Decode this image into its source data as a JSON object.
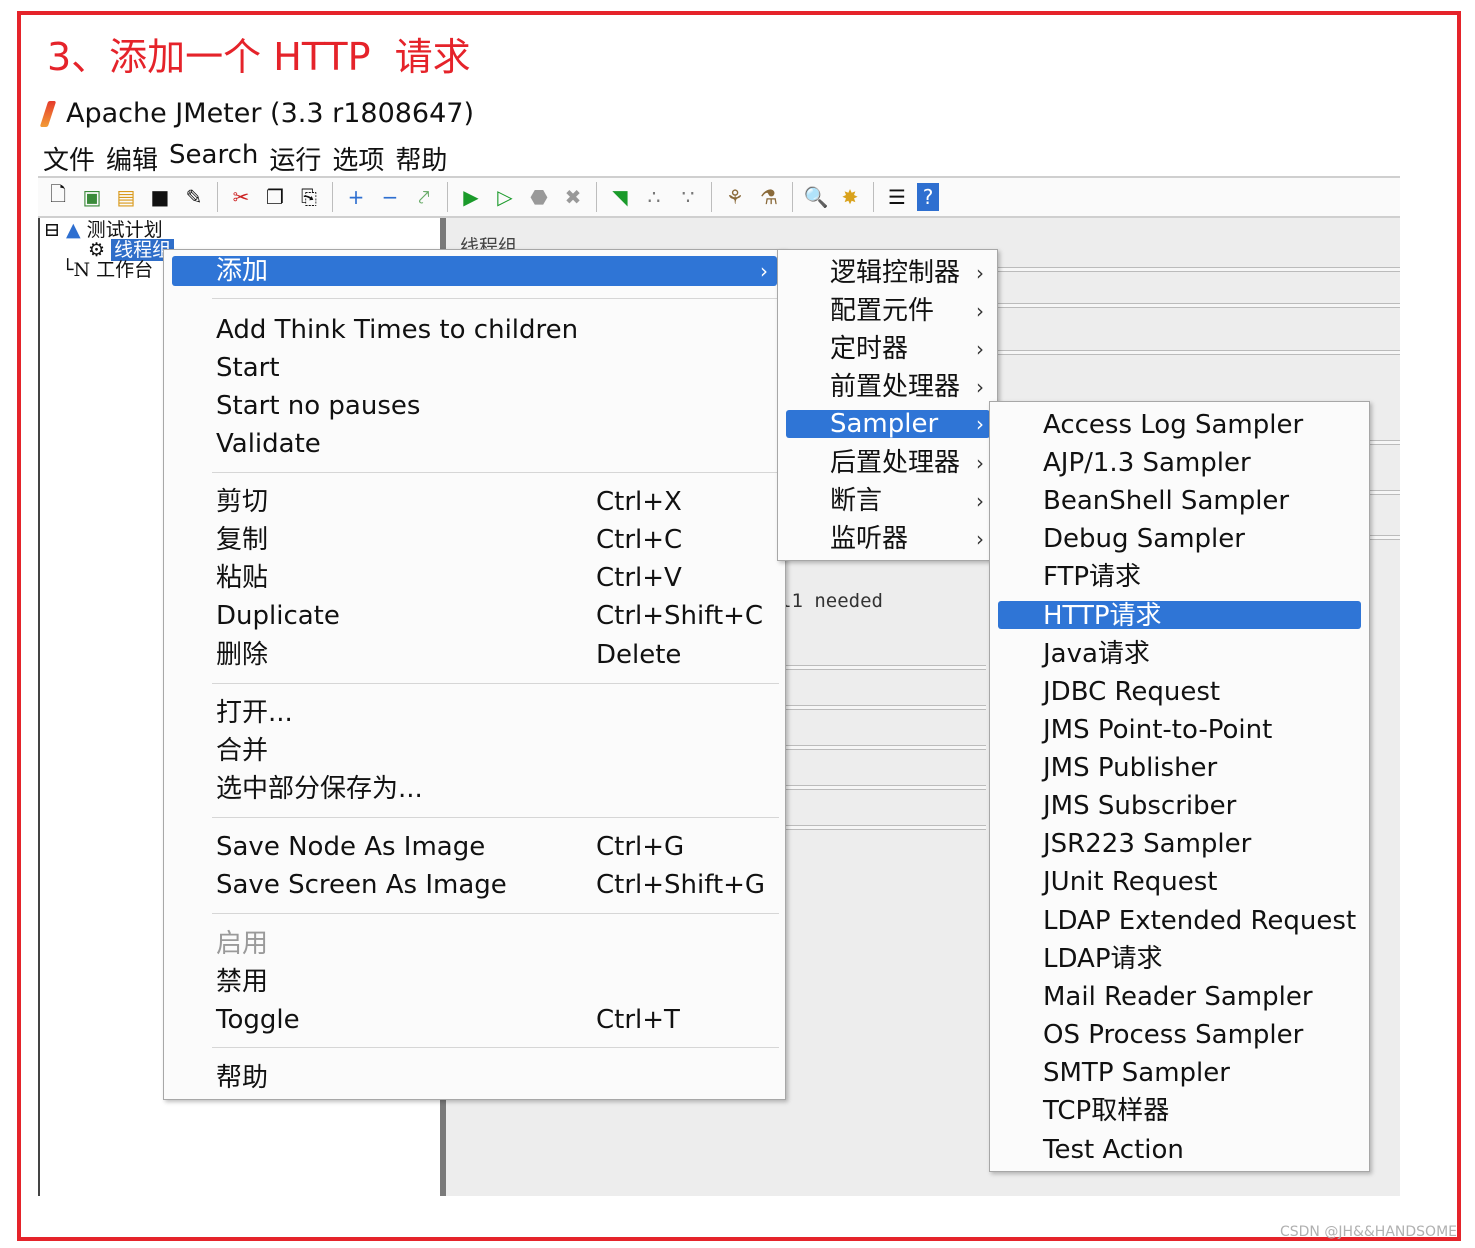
{
  "heading": "3、添加一个 HTTP  请求",
  "app": {
    "title": "Apache JMeter (3.3 r1808647)",
    "menubar": [
      "文件",
      "编辑",
      "Search",
      "运行",
      "选项",
      "帮助"
    ]
  },
  "toolbar_icons": [
    "new-icon",
    "templates-icon",
    "open-icon",
    "save-icon",
    "save-as-icon",
    "cut-icon",
    "copy-icon",
    "paste-icon",
    "expand-icon",
    "collapse-icon",
    "toggle-icon",
    "start-icon",
    "start-no-pause-icon",
    "stop-icon",
    "shutdown-icon",
    "remote-start-icon",
    "remote-stop-icon",
    "remote-shutdown-icon",
    "clear-icon",
    "clear-all-icon",
    "search-icon",
    "reset-search-icon",
    "function-helper-icon",
    "help-icon"
  ],
  "tree": {
    "test_plan": "测试计划",
    "thread_group": "线程组",
    "workbench": "工作台"
  },
  "right_pane": {
    "label": "线程组",
    "partial_text": "l1 needed"
  },
  "context_menu": {
    "add": "添加",
    "group1": [
      "Add Think Times to children",
      "Start",
      "Start no pauses",
      "Validate"
    ],
    "group2": [
      {
        "label": "剪切",
        "shortcut": "Ctrl+X"
      },
      {
        "label": "复制",
        "shortcut": "Ctrl+C"
      },
      {
        "label": "粘贴",
        "shortcut": "Ctrl+V"
      },
      {
        "label": "Duplicate",
        "shortcut": "Ctrl+Shift+C"
      },
      {
        "label": "删除",
        "shortcut": "Delete"
      }
    ],
    "group3": [
      "打开...",
      "合并",
      "选中部分保存为..."
    ],
    "group4": [
      {
        "label": "Save Node As Image",
        "shortcut": "Ctrl+G"
      },
      {
        "label": "Save Screen As Image",
        "shortcut": "Ctrl+Shift+G"
      }
    ],
    "group5": [
      {
        "label": "启用",
        "shortcut": ""
      },
      {
        "label": "禁用",
        "shortcut": ""
      },
      {
        "label": "Toggle",
        "shortcut": "Ctrl+T"
      }
    ],
    "help": "帮助"
  },
  "add_submenu": [
    "逻辑控制器",
    "配置元件",
    "定时器",
    "前置处理器",
    "Sampler",
    "后置处理器",
    "断言",
    "监听器"
  ],
  "sampler_submenu": [
    "Access Log Sampler",
    "AJP/1.3 Sampler",
    "BeanShell Sampler",
    "Debug Sampler",
    "FTP请求",
    "HTTP请求",
    "Java请求",
    "JDBC Request",
    "JMS Point-to-Point",
    "JMS Publisher",
    "JMS Subscriber",
    "JSR223 Sampler",
    "JUnit Request",
    "LDAP Extended Request",
    "LDAP请求",
    "Mail Reader Sampler",
    "OS Process Sampler",
    "SMTP Sampler",
    "TCP取样器",
    "Test Action"
  ],
  "credit": "CSDN @JH&&HANDSOME",
  "colors": {
    "frame": "#e5232a",
    "highlight": "#2f75d6"
  }
}
